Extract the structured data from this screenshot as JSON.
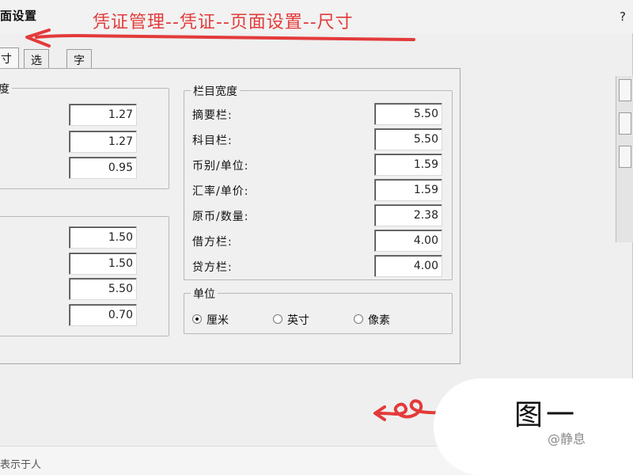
{
  "window": {
    "title": "面设置",
    "help": "?"
  },
  "annotation": {
    "text": "凭证管理--凭证--页面设置--尺寸",
    "color": "#e33a3a"
  },
  "tabs": [
    {
      "label": "寸",
      "active": true
    },
    {
      "label": "选项",
      "active": false
    },
    {
      "label": "字体",
      "active": false
    }
  ],
  "left_group1": {
    "title": "度",
    "values": [
      "1.27",
      "1.27",
      "0.95"
    ]
  },
  "left_group2": {
    "values": [
      "1.50",
      "1.50",
      "5.50",
      "0.70"
    ]
  },
  "column_widths": {
    "title": "栏目宽度",
    "rows": [
      {
        "label": "摘要栏:",
        "value": "5.50"
      },
      {
        "label": "科目栏:",
        "value": "5.50"
      },
      {
        "label": "币别/单位:",
        "value": "1.59"
      },
      {
        "label": "汇率/单价:",
        "value": "1.59"
      },
      {
        "label": "原币/数量:",
        "value": "2.38"
      },
      {
        "label": "借方栏:",
        "value": "4.00"
      },
      {
        "label": "贷方栏:",
        "value": "4.00"
      }
    ]
  },
  "unit": {
    "title": "单位",
    "options": [
      {
        "label": "厘米",
        "checked": true
      },
      {
        "label": "英寸",
        "checked": false
      },
      {
        "label": "像素",
        "checked": false
      }
    ]
  },
  "figure_label": "图一",
  "watermark": "@静息",
  "bottom_text": "表示于人"
}
